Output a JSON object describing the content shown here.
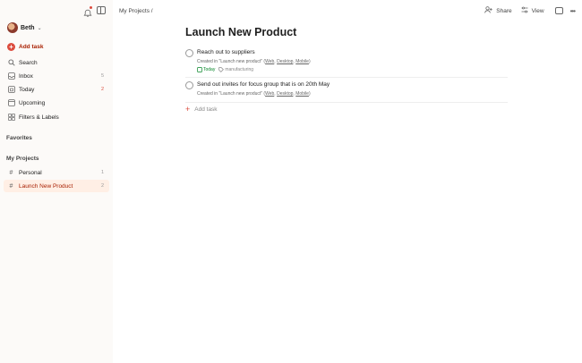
{
  "user": {
    "name": "Beth"
  },
  "sidebar": {
    "add_task": "Add task",
    "items": [
      {
        "label": "Search",
        "icon": "search-icon",
        "count": ""
      },
      {
        "label": "Inbox",
        "icon": "inbox-icon",
        "count": "5"
      },
      {
        "label": "Today",
        "icon": "calendar-today-icon",
        "count": "2"
      },
      {
        "label": "Upcoming",
        "icon": "calendar-upcoming-icon",
        "count": ""
      },
      {
        "label": "Filters & Labels",
        "icon": "filters-icon",
        "count": ""
      }
    ],
    "favorites_heading": "Favorites",
    "projects_heading": "My Projects",
    "projects": [
      {
        "label": "Personal",
        "count": "1"
      },
      {
        "label": "Launch New Product",
        "count": "2"
      }
    ]
  },
  "header": {
    "breadcrumb": "My Projects /",
    "share_label": "Share",
    "view_label": "View"
  },
  "main": {
    "title": "Launch New Product",
    "tasks": [
      {
        "title": "Reach out to suppliers",
        "desc_prefix": "Created in \"Launch new product\" (",
        "links": [
          "Web",
          "Desktop",
          "Mobile"
        ],
        "desc_suffix": ")",
        "due": "Today",
        "label": "manufacturing"
      },
      {
        "title": "Send out invites for focus group that is on 20th May",
        "desc_prefix": "Created in \"Launch new product\" (",
        "links": [
          "Web",
          "Desktop",
          "Mobile"
        ],
        "desc_suffix": ")"
      }
    ],
    "add_task": "Add task"
  },
  "colors": {
    "accent": "#dc4c3e",
    "accent_dark": "#a81f00",
    "due_green": "#058527",
    "sidebar_bg": "#fcfaf8",
    "active_bg": "#ffefe5"
  }
}
